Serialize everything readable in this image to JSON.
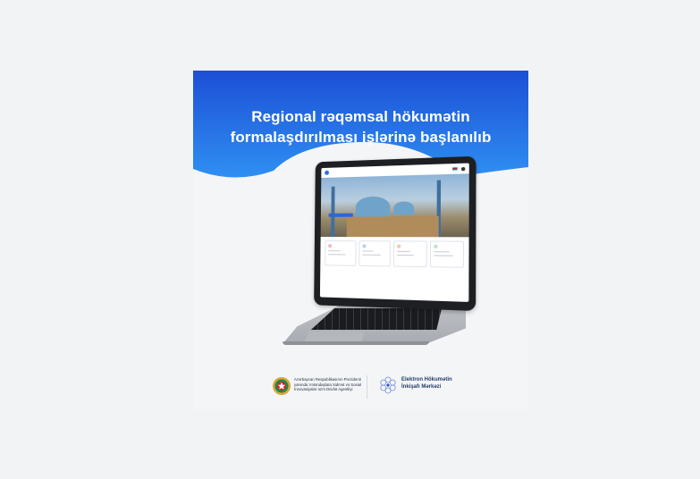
{
  "headline": {
    "line1": "Regional rəqəmsal hökumətin",
    "line2": "formalaşdırılması işlərinə başlanılıb"
  },
  "colors": {
    "banner_top": "#1f55d9",
    "banner_bottom": "#2e8ff0",
    "background": "#f4f5f7"
  },
  "footer": {
    "agency_name": "Azərbaycan Respublikasının Prezidenti yanında Vətəndaşlara Xidmət və Sosial İnnovasiyalar üzrə Dövlət Agentliyi",
    "center_name_line1": "Elektron Hökumətin",
    "center_name_line2": "İnkişafı Mərkəzi"
  },
  "icons": [
    "state-emblem-icon",
    "e-government-center-logo-icon",
    "laptop-illustration"
  ]
}
